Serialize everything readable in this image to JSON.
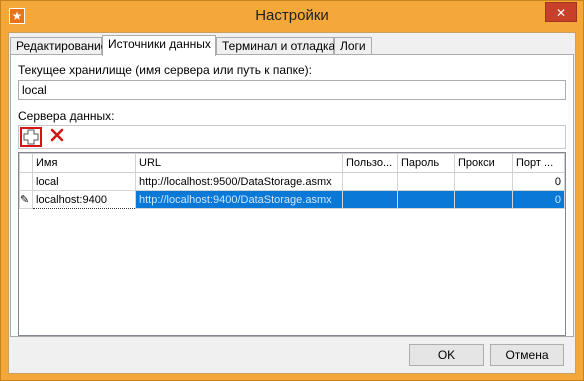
{
  "window": {
    "title": "Настройки",
    "close_glyph": "✕",
    "app_icon_glyph": "★"
  },
  "tabs": [
    {
      "label": "Редактирование"
    },
    {
      "label": "Источники данных"
    },
    {
      "label": "Терминал и отладка"
    },
    {
      "label": "Логи"
    }
  ],
  "storage": {
    "label": "Текущее хранилище (имя сервера или путь к папке):",
    "value": "local"
  },
  "servers": {
    "label": "Сервера данных:",
    "add_icon": "plus-icon",
    "delete_icon": "red-x-icon",
    "columns": [
      "Имя",
      "URL",
      "Пользо...",
      "Пароль",
      "Прокси",
      "Порт ..."
    ],
    "rows": [
      {
        "marker": "",
        "name": "local",
        "url": "http://localhost:9500/DataStorage.asmx",
        "user": "",
        "password": "",
        "proxy": "",
        "port": "0"
      },
      {
        "marker": "✎",
        "name": "localhost:9400",
        "url": "http://localhost:9400/DataStorage.asmx",
        "user": "",
        "password": "",
        "proxy": "",
        "port": "0"
      }
    ]
  },
  "buttons": {
    "ok": "OK",
    "cancel": "Отмена"
  },
  "colors": {
    "accent": "#f5a83a",
    "selection": "#0a78d7",
    "delete": "#d41515"
  }
}
